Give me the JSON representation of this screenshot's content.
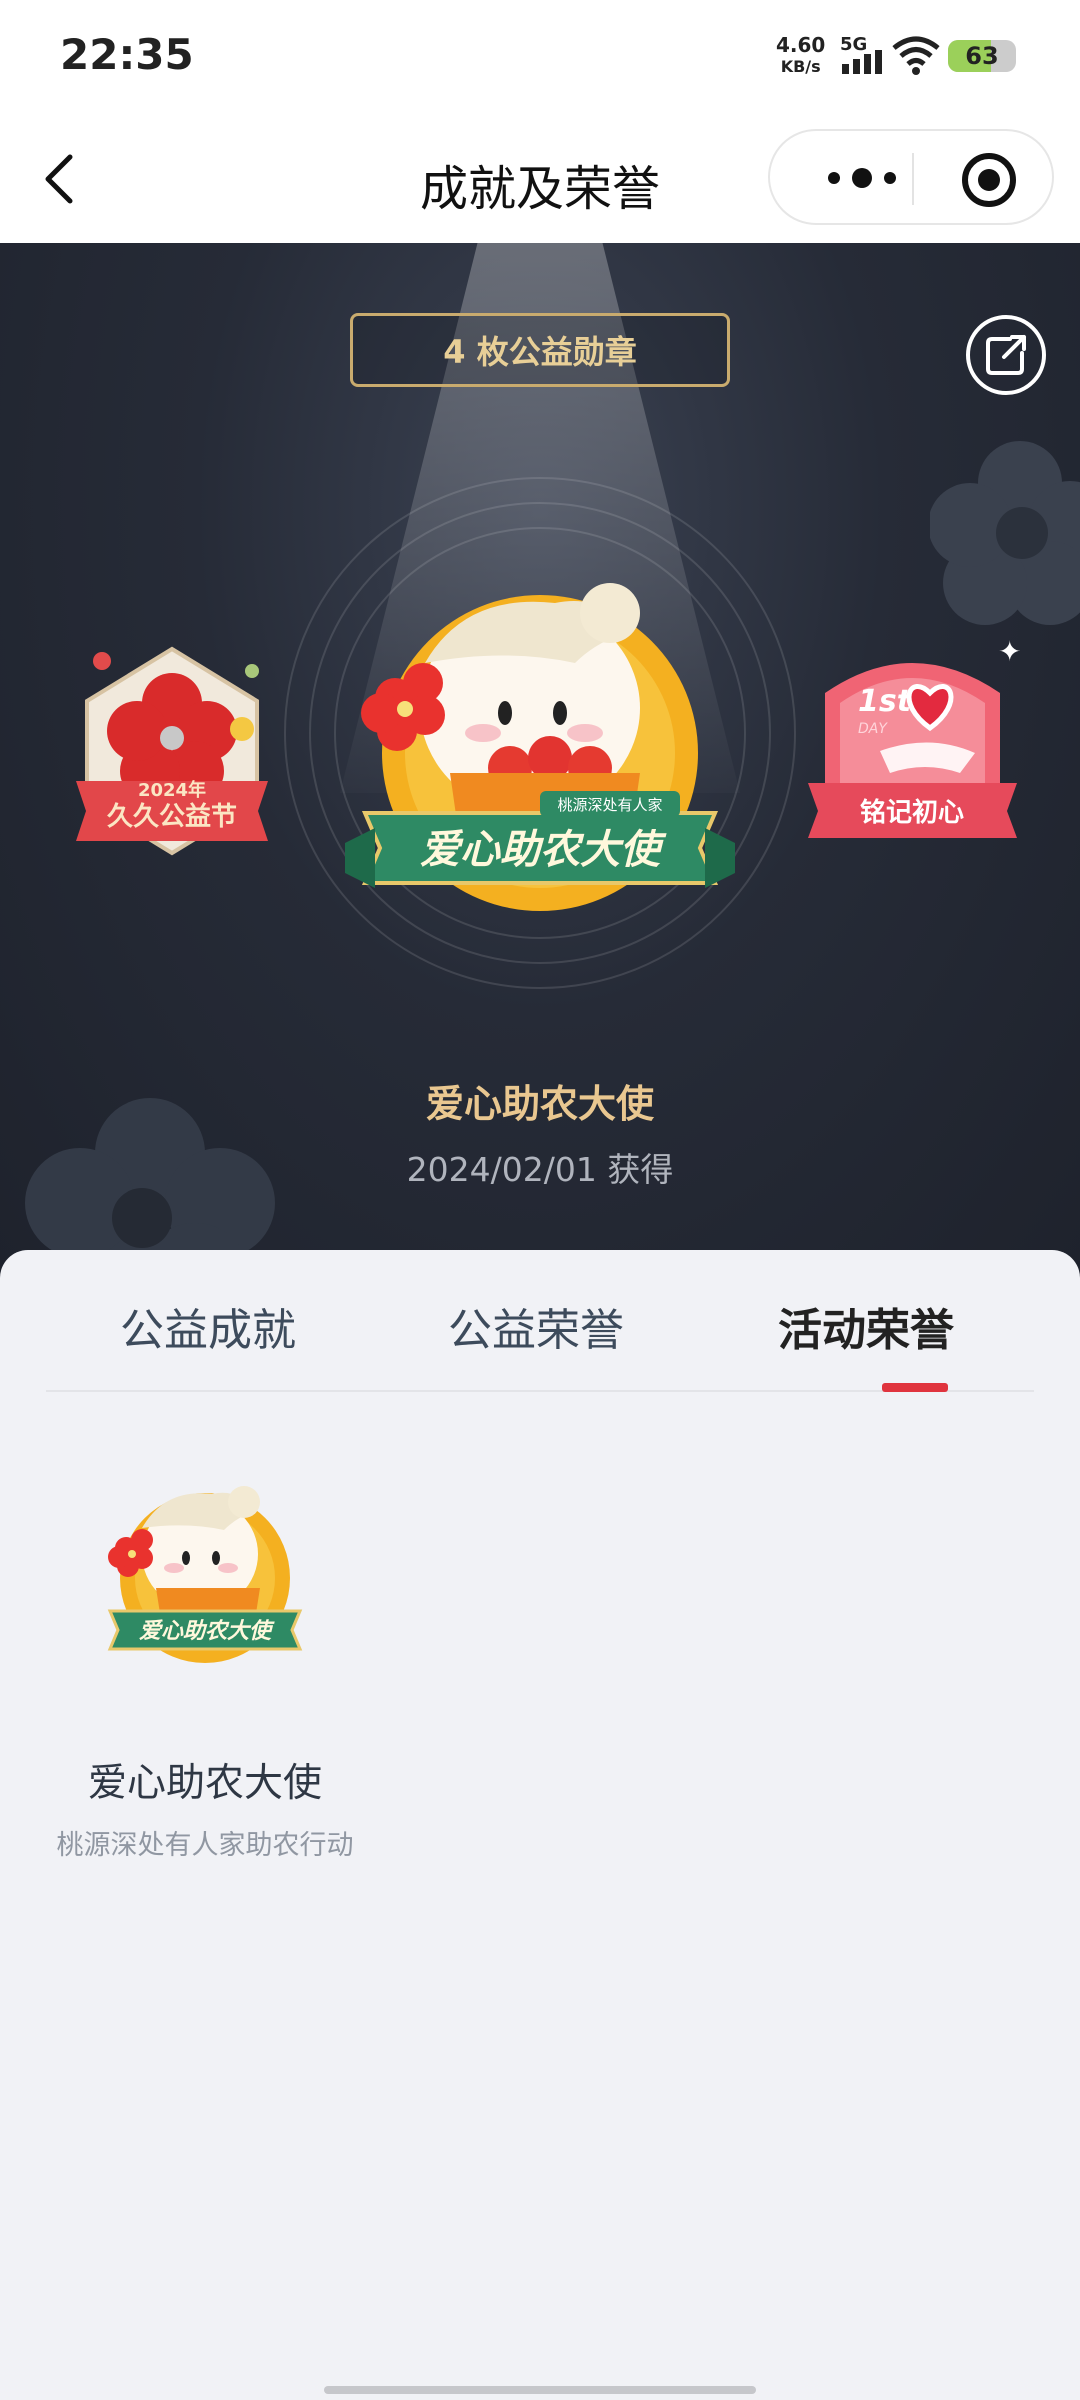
{
  "status_bar": {
    "time": "22:35",
    "net_speed": "4.60",
    "net_unit": "KB/s",
    "network": "5G",
    "battery": "63",
    "battery_level": 0.63
  },
  "nav": {
    "title": "成就及荣誉"
  },
  "hero": {
    "medal_count": "4 枚公益勋章",
    "left_badge_text_top": "2024年",
    "left_badge_text": "久久公益节",
    "right_badge_corner": "1st",
    "right_badge_day": "DAY",
    "right_badge_text": "铭记初心",
    "main_badge_ribbon": "爱心助农大使",
    "main_badge_tag": "桃源深处有人家",
    "selected_name": "爱心助农大使",
    "selected_date": "2024/02/01 获得"
  },
  "tabs": [
    {
      "label": "公益成就"
    },
    {
      "label": "公益荣誉"
    },
    {
      "label": "活动荣誉"
    }
  ],
  "active_tab": "活动荣誉",
  "cards": [
    {
      "title": "爱心助农大使",
      "subtitle": "桃源深处有人家助农行动",
      "ribbon": "爱心助农大使"
    }
  ],
  "colors": {
    "accent_red": "#e0343e",
    "gold": "#e9c790",
    "hero_bg": "#262b37",
    "ribbon_green": "#2e8a64"
  }
}
